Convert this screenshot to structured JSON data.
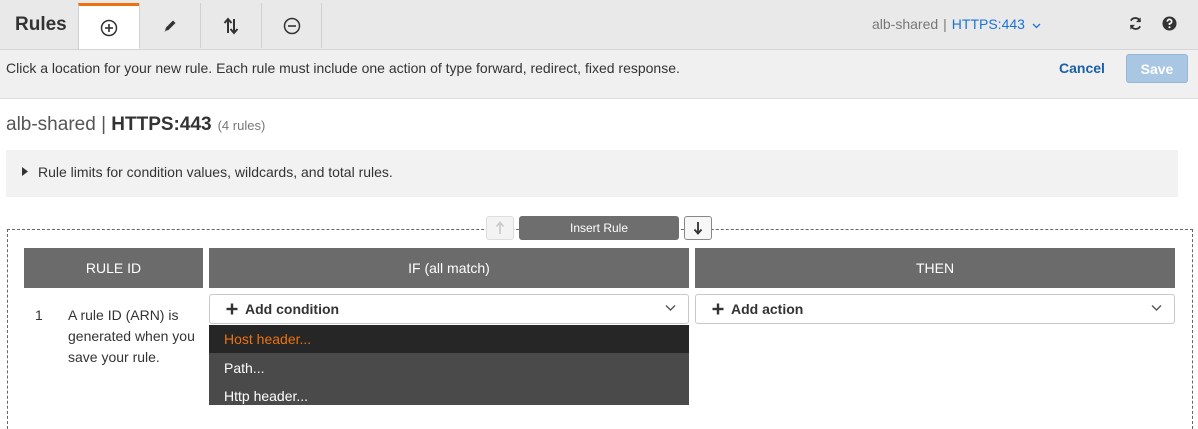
{
  "toolbar": {
    "title": "Rules",
    "tabs": [
      {
        "name": "add-rules-tab",
        "icon": "plus-circle-icon",
        "active": true
      },
      {
        "name": "edit-rules-tab",
        "icon": "pencil-icon",
        "active": false
      },
      {
        "name": "reorder-rules-tab",
        "icon": "reorder-arrows-icon",
        "active": false
      },
      {
        "name": "delete-rules-tab",
        "icon": "minus-circle-icon",
        "active": false
      }
    ],
    "lb_name": "alb-shared",
    "separator": "|",
    "listener": "HTTPS:443",
    "refresh_icon": "refresh-icon",
    "help_icon": "help-icon"
  },
  "instruction_bar": {
    "text": "Click a location for your new rule. Each rule must include one action of type forward, redirect, fixed response.",
    "cancel_label": "Cancel",
    "save_label": "Save"
  },
  "heading": {
    "lb_name": "alb-shared",
    "separator": "|",
    "listener": "HTTPS:443",
    "count": "(4 rules)"
  },
  "limits": {
    "text": "Rule limits for condition values, wildcards, and total rules."
  },
  "insert": {
    "label": "Insert Rule"
  },
  "table": {
    "columns": [
      "RULE ID",
      "IF (all match)",
      "THEN"
    ],
    "row": {
      "number": "1",
      "description": "A rule ID (ARN) is generated when you save your rule.",
      "condition_label": "Add condition",
      "action_label": "Add action"
    }
  },
  "condition_menu": {
    "items": [
      "Host header...",
      "Path...",
      "Http header..."
    ]
  },
  "colors": {
    "accent": "#ec7211",
    "link": "#1a73d9",
    "header_bg": "#6b6b6b",
    "menu_bg": "#4a4a4a"
  }
}
